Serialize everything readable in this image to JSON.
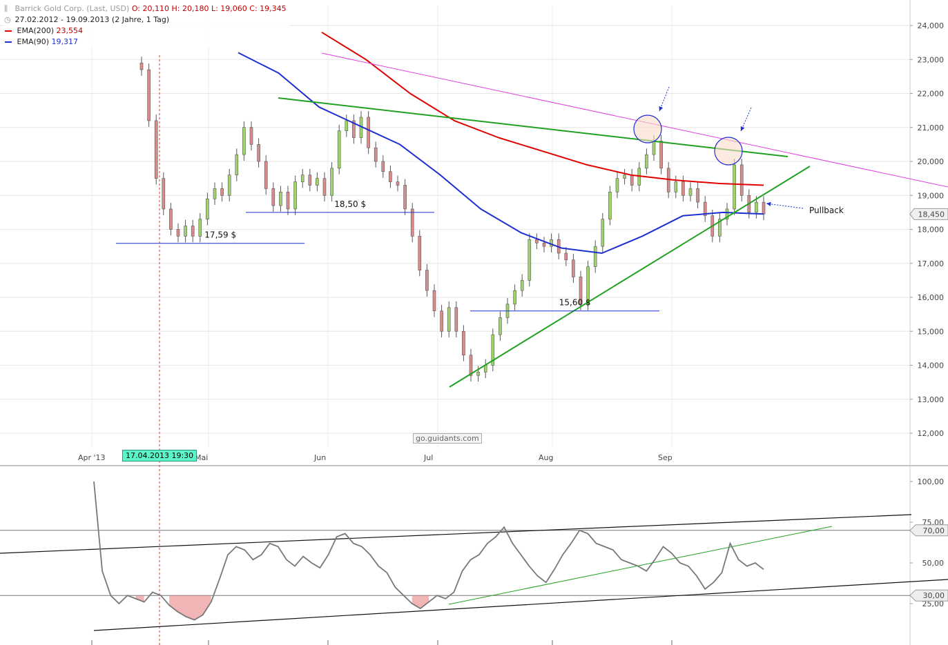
{
  "legend": {
    "title": "Barrick Gold Corp. (Last, USD)",
    "ohlc": {
      "o": "O: 20,110",
      "h": "H: 20,180",
      "l": "L: 19,060",
      "c": "C: 19,345"
    },
    "range": "27.02.2012 - 19.09.2013 (2 Jahre, 1 Tag)",
    "ema200": {
      "label": "EMA(200)",
      "value": "23,554",
      "color": "#e00000"
    },
    "ema90": {
      "label": "EMA(90)",
      "value": "19,317",
      "color": "#1c2fd1"
    }
  },
  "cursor_label": "17.04.2013 19:30",
  "watermark": "go.guidants.com",
  "chart_data": [
    {
      "type": "candlestick",
      "title": "Barrick Gold Corp. (Last, USD)",
      "x_labels": [
        "Apr '13",
        "Mai",
        "Jun",
        "Jul",
        "Aug",
        "Sep"
      ],
      "y_ticks": [
        "24,000",
        "23,000",
        "22,000",
        "21,000",
        "20,000",
        "19,000",
        "18,000",
        "17,000",
        "16,000",
        "15,000",
        "14,000",
        "13,000",
        "12,000"
      ],
      "ylim": [
        11.8,
        24.6
      ],
      "last_price_label": "18,450",
      "close_series_approx": [
        22.7,
        21.2,
        19.5,
        18.6,
        18.0,
        17.8,
        18.1,
        17.8,
        18.3,
        18.9,
        19.2,
        19.0,
        19.6,
        20.2,
        21.0,
        20.5,
        20.0,
        19.2,
        18.7,
        19.1,
        18.6,
        19.4,
        19.6,
        19.3,
        19.5,
        19.0,
        19.8,
        20.9,
        21.2,
        20.7,
        21.3,
        20.4,
        20.0,
        19.7,
        19.4,
        19.3,
        18.6,
        17.8,
        16.8,
        16.2,
        15.6,
        15.0,
        15.7,
        15.0,
        14.3,
        13.7,
        13.8,
        14.0,
        14.9,
        15.4,
        15.8,
        16.2,
        16.5,
        17.7,
        17.6,
        17.5,
        17.7,
        17.3,
        17.1,
        16.6,
        15.8,
        16.9,
        17.5,
        18.3,
        19.1,
        19.5,
        19.6,
        19.3,
        19.8,
        20.2,
        20.6,
        19.8,
        19.1,
        19.4,
        19.0,
        19.2,
        18.8,
        18.4,
        17.8,
        18.3,
        18.6,
        19.9,
        19.0,
        18.5,
        18.8,
        18.45
      ],
      "ema200_approx": [
        23.8,
        23.0,
        22.0,
        21.2,
        20.7,
        20.3,
        19.9,
        19.6,
        19.45,
        19.35,
        19.3
      ],
      "ema90_approx": [
        23.2,
        22.6,
        21.6,
        21.05,
        20.5,
        19.6,
        18.6,
        17.9,
        17.45,
        17.3,
        17.8,
        18.4,
        18.5,
        18.45
      ],
      "support_levels": [
        {
          "label": "17,59  $",
          "value": 17.59
        },
        {
          "label": "18,50  $",
          "value": 18.5
        },
        {
          "label": "15,60  $",
          "value": 15.6
        }
      ],
      "annotations": [
        "Pullback"
      ]
    },
    {
      "type": "line",
      "title": "",
      "y_ticks": [
        "100,00",
        "75,00",
        "50,00",
        "25,00"
      ],
      "ylim": [
        8,
        100
      ],
      "levels": [
        {
          "label": "70,00",
          "value": 70
        },
        {
          "label": "30,00",
          "value": 30
        }
      ],
      "values_approx": [
        100,
        45,
        30,
        25,
        30,
        28,
        26,
        32,
        30,
        24,
        20,
        17,
        15,
        18,
        26,
        40,
        55,
        60,
        58,
        52,
        55,
        62,
        60,
        52,
        48,
        54,
        50,
        47,
        55,
        66,
        68,
        62,
        60,
        55,
        48,
        44,
        35,
        30,
        25,
        22,
        26,
        30,
        28,
        32,
        45,
        52,
        55,
        62,
        66,
        72,
        62,
        55,
        48,
        42,
        38,
        46,
        55,
        62,
        70,
        68,
        62,
        60,
        58,
        52,
        50,
        48,
        45,
        52,
        60,
        56,
        50,
        48,
        42,
        34,
        38,
        44,
        62,
        52,
        48,
        50,
        46
      ]
    }
  ]
}
